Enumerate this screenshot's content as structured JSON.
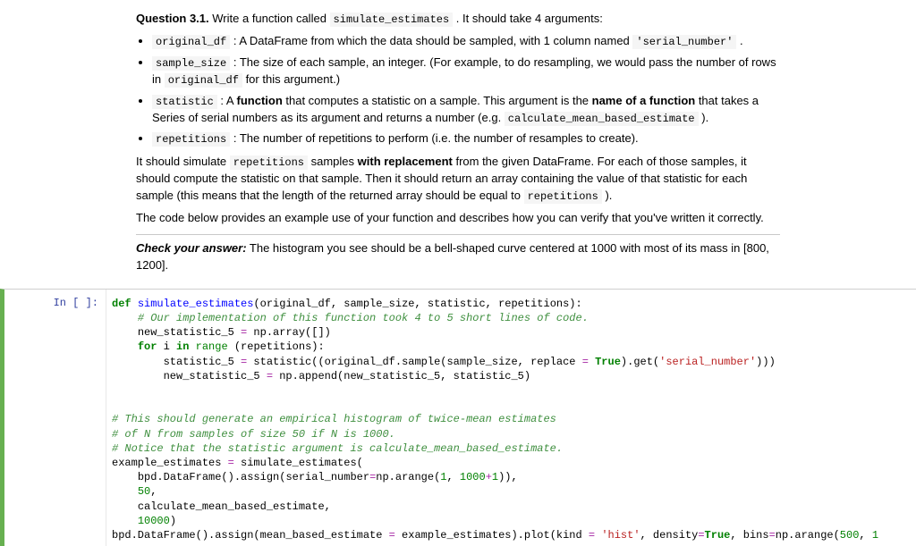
{
  "question": {
    "label": "Question 3.1.",
    "intro_before": "Write a function called ",
    "fn_name": "simulate_estimates",
    "intro_after": ". It should take 4 arguments:"
  },
  "args": [
    {
      "name": "original_df",
      "desc_a": " : A DataFrame from which the data should be sampled, with 1 column named ",
      "code_b": "'serial_number'",
      "desc_b": " ."
    },
    {
      "name": "sample_size",
      "desc_a": " : The size of each sample, an integer. (For example, to do resampling, we would pass the number of rows in ",
      "code_b": "original_df",
      "desc_b": " for this argument.)"
    },
    {
      "name": "statistic",
      "desc_a": " : A ",
      "bold_a": "function",
      "desc_b": " that computes a statistic on a sample. This argument is the ",
      "bold_b": "name of a function",
      "desc_c": " that takes a Series of serial numbers as its argument and returns a number (e.g. ",
      "code_b": "calculate_mean_based_estimate",
      "desc_d": " )."
    },
    {
      "name": "repetitions",
      "desc_a": " : The number of repetitions to perform (i.e. the number of resamples to create)."
    }
  ],
  "body": {
    "p1_a": "It should simulate ",
    "p1_code1": "repetitions",
    "p1_b": " samples ",
    "p1_bold": "with replacement",
    "p1_c": " from the given DataFrame. For each of those samples, it should compute the statistic on that sample. Then it should return an array containing the value of that statistic for each sample (this means that the length of the returned array should be equal to ",
    "p1_code2": "repetitions",
    "p1_d": " ).",
    "p2": "The code below provides an example use of your function and describes how you can verify that you've written it correctly.",
    "check_label": "Check your answer:",
    "check_text": " The histogram you see should be a bell-shaped curve centered at 1000 with most of its mass in [800, 1200]."
  },
  "cell": {
    "prompt": "In [ ]:",
    "lines": {
      "l0": {
        "k": "def",
        "fn": "simulate_estimates",
        "args": "(original_df, sample_size, statistic, repetitions):"
      },
      "c1": "# Our implementation of this function took 4 to 5 short lines of code.",
      "l2a": "new_statistic_5 ",
      "l2b": "=",
      "l2c": " np.array([])",
      "l3a": "for",
      "l3b": " i ",
      "l3c": "in",
      "l3d": " ",
      "l3e": "range",
      "l3f": " (repetitions):",
      "l4a": "statistic_5 ",
      "l4b": "=",
      "l4c": " statistic((original_df.sample(sample_size, replace ",
      "l4d": "=",
      "l4e": " ",
      "l4f": "True",
      "l4g": ").get(",
      "l4h": "'serial_number'",
      "l4i": ")))",
      "l5a": "new_statistic_5 ",
      "l5b": "=",
      "l5c": " np.append(new_statistic_5, statistic_5)",
      "c6": "# This should generate an empirical histogram of twice-mean estimates",
      "c7": "# of N from samples of size 50 if N is 1000.",
      "c8": "# Notice that the statistic argument is calculate_mean_based_estimate.",
      "l9a": "example_estimates ",
      "l9b": "=",
      "l9c": " simulate_estimates(",
      "l10a": "bpd.DataFrame().assign(serial_number",
      "l10b": "=",
      "l10c": "np.arange(",
      "l10d": "1",
      "l10e": ", ",
      "l10f": "1000",
      "l10g": "+",
      "l10h": "1",
      "l10i": ")),",
      "l11": "50",
      "l11b": ",",
      "l12": "calculate_mean_based_estimate,",
      "l13": "10000",
      "l13b": ")",
      "l14a": "bpd.DataFrame().assign(mean_based_estimate ",
      "l14b": "=",
      "l14c": " example_estimates).plot(kind ",
      "l14d": "=",
      "l14e": " ",
      "l14f": "'hist'",
      "l14g": ", density",
      "l14h": "=",
      "l14i": "True",
      "l14j": ", bins",
      "l14k": "=",
      "l14l": "np.arange(",
      "l14m": "500",
      "l14n": ", ",
      "l14o": "1"
    }
  }
}
